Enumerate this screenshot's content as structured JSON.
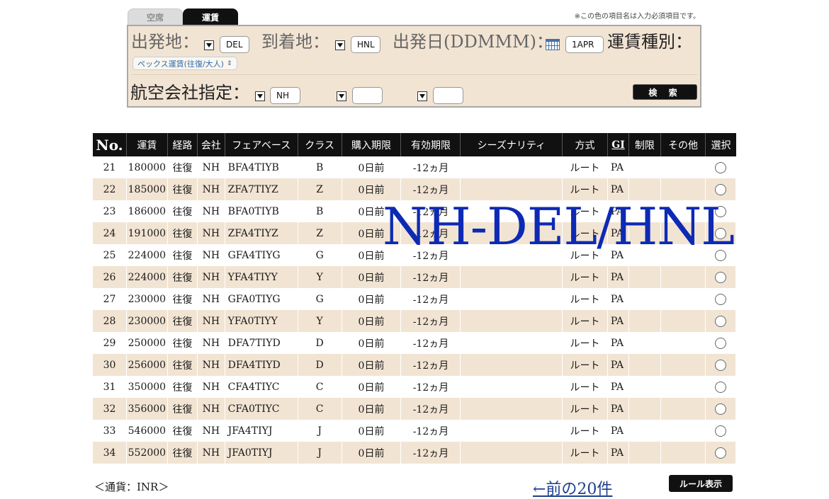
{
  "tabs": {
    "seat": "空席",
    "fare": "運賃"
  },
  "required_note": "※この色の項目名は入力必須項目です。",
  "search": {
    "departure_label": "出発地：",
    "departure_value": "DEL",
    "arrival_label": "到着地：",
    "arrival_value": "HNL",
    "date_label": "出発日(DDMMM)：",
    "date_value": "1APR",
    "fare_type_label": "運賃種別：",
    "fare_type_value": "ペックス運賃(往復/大人)",
    "airline_label": "航空会社指定：",
    "airline_values": [
      "NH",
      "",
      ""
    ],
    "search_button": "検 索"
  },
  "table": {
    "headers": [
      "No.",
      "運賃",
      "経路",
      "会社",
      "フェアベース",
      "クラス",
      "購入期限",
      "有効期限",
      "シーズナリティ",
      "方式",
      "GI",
      "制限",
      "その他",
      "選択"
    ],
    "rows": [
      {
        "no": "21",
        "fare": "180000",
        "route": "往復",
        "carrier": "NH",
        "basis": "BFA4TIYB",
        "cls": "B",
        "purchase": "0日前",
        "validity": "-12ヵ月",
        "season": "",
        "method": "ルート",
        "gi": "PA",
        "restrict": "",
        "other": ""
      },
      {
        "no": "22",
        "fare": "185000",
        "route": "往復",
        "carrier": "NH",
        "basis": "ZFA7TIYZ",
        "cls": "Z",
        "purchase": "0日前",
        "validity": "-12ヵ月",
        "season": "",
        "method": "ルート",
        "gi": "PA",
        "restrict": "",
        "other": ""
      },
      {
        "no": "23",
        "fare": "186000",
        "route": "往復",
        "carrier": "NH",
        "basis": "BFA0TIYB",
        "cls": "B",
        "purchase": "0日前",
        "validity": "-12ヵ月",
        "season": "",
        "method": "ルート",
        "gi": "PA",
        "restrict": "",
        "other": ""
      },
      {
        "no": "24",
        "fare": "191000",
        "route": "往復",
        "carrier": "NH",
        "basis": "ZFA4TIYZ",
        "cls": "Z",
        "purchase": "0日前",
        "validity": "-12ヵ月",
        "season": "",
        "method": "ルート",
        "gi": "PA",
        "restrict": "",
        "other": ""
      },
      {
        "no": "25",
        "fare": "224000",
        "route": "往復",
        "carrier": "NH",
        "basis": "GFA4TIYG",
        "cls": "G",
        "purchase": "0日前",
        "validity": "-12ヵ月",
        "season": "",
        "method": "ルート",
        "gi": "PA",
        "restrict": "",
        "other": ""
      },
      {
        "no": "26",
        "fare": "224000",
        "route": "往復",
        "carrier": "NH",
        "basis": "YFA4TIYY",
        "cls": "Y",
        "purchase": "0日前",
        "validity": "-12ヵ月",
        "season": "",
        "method": "ルート",
        "gi": "PA",
        "restrict": "",
        "other": ""
      },
      {
        "no": "27",
        "fare": "230000",
        "route": "往復",
        "carrier": "NH",
        "basis": "GFA0TIYG",
        "cls": "G",
        "purchase": "0日前",
        "validity": "-12ヵ月",
        "season": "",
        "method": "ルート",
        "gi": "PA",
        "restrict": "",
        "other": ""
      },
      {
        "no": "28",
        "fare": "230000",
        "route": "往復",
        "carrier": "NH",
        "basis": "YFA0TIYY",
        "cls": "Y",
        "purchase": "0日前",
        "validity": "-12ヵ月",
        "season": "",
        "method": "ルート",
        "gi": "PA",
        "restrict": "",
        "other": ""
      },
      {
        "no": "29",
        "fare": "250000",
        "route": "往復",
        "carrier": "NH",
        "basis": "DFA7TIYD",
        "cls": "D",
        "purchase": "0日前",
        "validity": "-12ヵ月",
        "season": "",
        "method": "ルート",
        "gi": "PA",
        "restrict": "",
        "other": ""
      },
      {
        "no": "30",
        "fare": "256000",
        "route": "往復",
        "carrier": "NH",
        "basis": "DFA4TIYD",
        "cls": "D",
        "purchase": "0日前",
        "validity": "-12ヵ月",
        "season": "",
        "method": "ルート",
        "gi": "PA",
        "restrict": "",
        "other": ""
      },
      {
        "no": "31",
        "fare": "350000",
        "route": "往復",
        "carrier": "NH",
        "basis": "CFA4TIYC",
        "cls": "C",
        "purchase": "0日前",
        "validity": "-12ヵ月",
        "season": "",
        "method": "ルート",
        "gi": "PA",
        "restrict": "",
        "other": ""
      },
      {
        "no": "32",
        "fare": "356000",
        "route": "往復",
        "carrier": "NH",
        "basis": "CFA0TIYC",
        "cls": "C",
        "purchase": "0日前",
        "validity": "-12ヵ月",
        "season": "",
        "method": "ルート",
        "gi": "PA",
        "restrict": "",
        "other": ""
      },
      {
        "no": "33",
        "fare": "546000",
        "route": "往復",
        "carrier": "NH",
        "basis": "JFA4TIYJ",
        "cls": "J",
        "purchase": "0日前",
        "validity": "-12ヵ月",
        "season": "",
        "method": "ルート",
        "gi": "PA",
        "restrict": "",
        "other": ""
      },
      {
        "no": "34",
        "fare": "552000",
        "route": "往復",
        "carrier": "NH",
        "basis": "JFA0TIYJ",
        "cls": "J",
        "purchase": "0日前",
        "validity": "-12ヵ月",
        "season": "",
        "method": "ルート",
        "gi": "PA",
        "restrict": "",
        "other": ""
      }
    ]
  },
  "overlay_text": "NH-DEL/HNL",
  "footer": {
    "currency": "＜通貨：INR＞",
    "prev_link": "←前の20件",
    "rule_button": "ルール表示"
  },
  "colors": {
    "header_bg": "#111111",
    "stripe": "#f2e4d3",
    "overlay": "#0d2ab4",
    "link": "#1e3f8c"
  }
}
